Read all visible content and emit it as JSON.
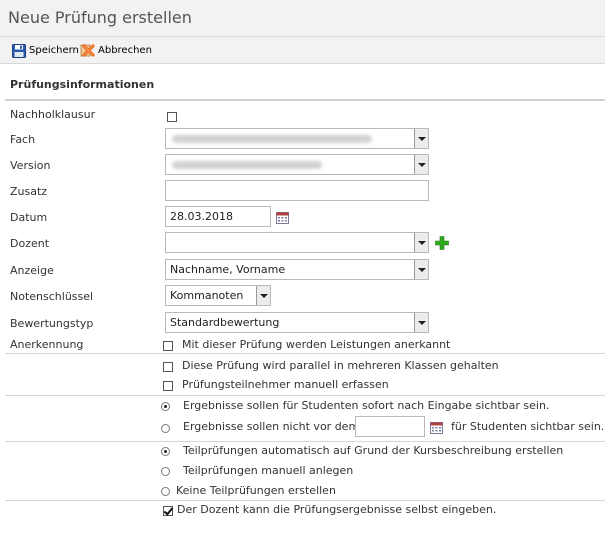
{
  "window": {
    "title": "Neue Prüfung erstellen"
  },
  "toolbar": {
    "save_label": "Speichern",
    "cancel_label": "Abbrechen"
  },
  "section": {
    "title": "Prüfungsinformationen"
  },
  "form": {
    "nachholklausur": {
      "label": "Nachholklausur",
      "checked": false
    },
    "fach": {
      "label": "Fach",
      "value": ""
    },
    "version": {
      "label": "Version",
      "value": ""
    },
    "zusatz": {
      "label": "Zusatz",
      "value": ""
    },
    "datum": {
      "label": "Datum",
      "value": "28.03.2018"
    },
    "dozent": {
      "label": "Dozent",
      "value": ""
    },
    "anzeige": {
      "label": "Anzeige",
      "value": "Nachname, Vorname"
    },
    "notenschluessel": {
      "label": "Notenschlüssel",
      "value": "Kommanoten"
    },
    "bewertungstyp": {
      "label": "Bewertungstyp",
      "value": "Standardbewertung"
    },
    "anerkennung": {
      "label": "Anerkennung"
    }
  },
  "options": {
    "anerkannt": {
      "text": "Mit dieser Prüfung werden Leistungen anerkannt",
      "checked": false
    },
    "parallel": {
      "text": "Diese Prüfung wird parallel in mehreren Klassen gehalten",
      "checked": false
    },
    "manuell_erfassen": {
      "text": "Prüfungsteilnehmer manuell erfassen",
      "checked": false
    },
    "sofort_sichtbar": {
      "text": "Ergebnisse sollen für Studenten sofort nach Eingabe sichtbar sein.",
      "selected": true
    },
    "nicht_vor": {
      "text_before": "Ergebnisse sollen nicht vor dem",
      "text_after": "für Studenten sichtbar sein.",
      "date_value": "",
      "selected": false
    },
    "teil_auto": {
      "text": "Teilprüfungen automatisch auf Grund der Kursbeschreibung erstellen",
      "selected": true
    },
    "teil_manuell": {
      "text": "Teilprüfungen manuell anlegen",
      "selected": false
    },
    "keine_teil": {
      "text": "Keine Teilprüfungen erstellen",
      "selected": false
    },
    "dozent_eingabe": {
      "text": "Der Dozent kann die Prüfungsergebnisse selbst eingeben.",
      "checked": true
    }
  },
  "icons": {
    "save": "floppy-disk-icon",
    "cancel": "cancel-x-icon",
    "calendar": "calendar-icon",
    "add": "plus-icon"
  },
  "colors": {
    "plus_green": "#2eaa1e",
    "cancel_orange": "#e8641e",
    "save_blue": "#2a5db0"
  }
}
